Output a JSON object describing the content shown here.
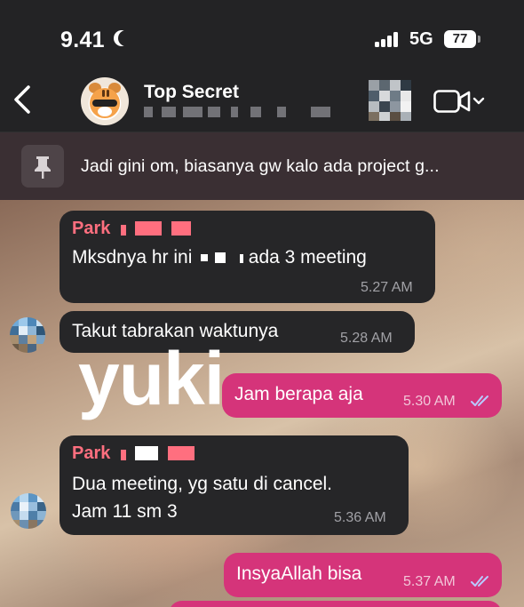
{
  "status_bar": {
    "time": "9.41",
    "network": "5G",
    "battery": "77"
  },
  "header": {
    "title": "Top Secret"
  },
  "pinned": {
    "text": "Jadi gini om, biasanya gw kalo ada project g..."
  },
  "messages": [
    {
      "sender": "Park",
      "text_before": "Mksdnya hr ini",
      "text_after": "ada 3 meeting",
      "time": "5.27 AM"
    },
    {
      "text": "Takut tabrakan waktunya",
      "time": "5.28 AM"
    },
    {
      "text": "Jam berapa aja",
      "time": "5.30 AM"
    },
    {
      "sender": "Park",
      "line1": "Dua meeting, yg satu di cancel.",
      "line2": "Jam 11 sm 3",
      "time": "5.36 AM"
    },
    {
      "text": "InsyaAllah bisa",
      "time": "5.37 AM"
    }
  ],
  "watermark": "yuki",
  "colors": {
    "outgoing_bubble": "#d5347a",
    "incoming_bubble": "#262628",
    "sender_name": "#ff6f7f"
  }
}
